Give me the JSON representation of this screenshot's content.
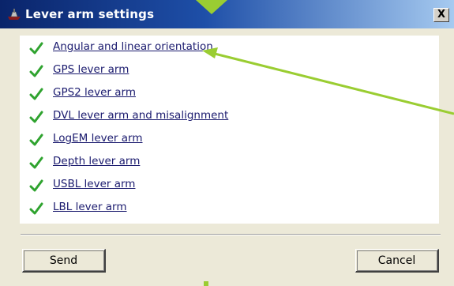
{
  "window": {
    "title": "Lever arm settings",
    "close_label": "X"
  },
  "items": [
    {
      "label": "Angular and linear orientation",
      "status": "check-icon"
    },
    {
      "label": "GPS lever arm",
      "status": "check-icon"
    },
    {
      "label": "GPS2 lever arm",
      "status": "check-icon"
    },
    {
      "label": "DVL lever arm and misalignment",
      "status": "check-icon"
    },
    {
      "label": "LogEM lever arm",
      "status": "check-icon"
    },
    {
      "label": "Depth lever arm",
      "status": "check-icon"
    },
    {
      "label": "USBL lever arm",
      "status": "check-icon"
    },
    {
      "label": "LBL lever arm",
      "status": "check-icon"
    }
  ],
  "buttons": {
    "send_label": "Send",
    "cancel_label": "Cancel"
  },
  "colors": {
    "titlebar": "#0a246a",
    "check": "#2fa32f",
    "link": "#1a1a6e",
    "annotation": "#9acd32"
  }
}
